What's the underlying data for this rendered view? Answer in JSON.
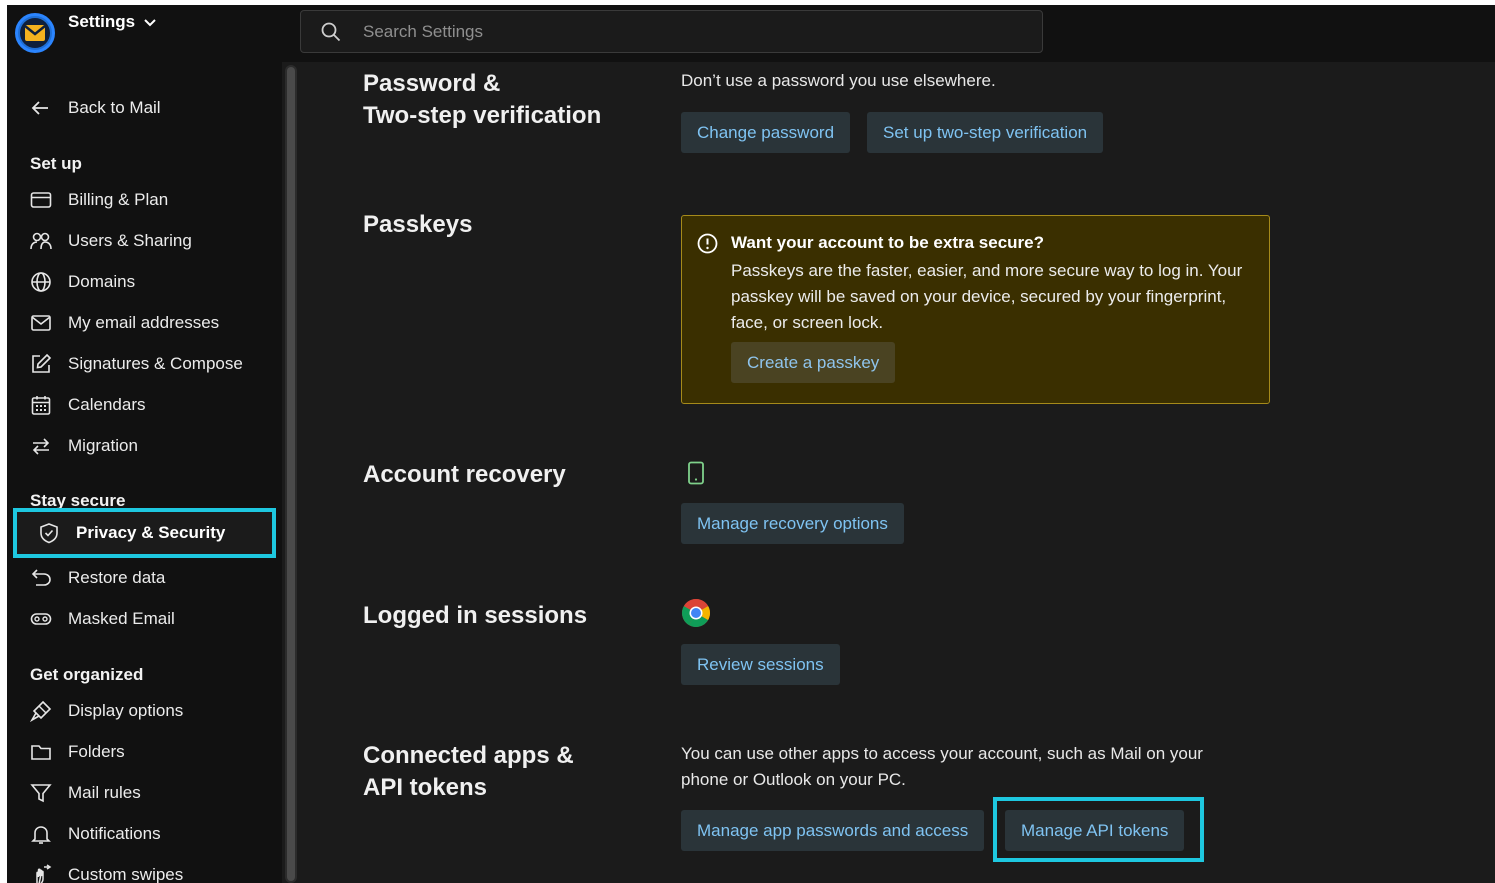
{
  "header": {
    "app_title": "Settings",
    "search_placeholder": "Search Settings"
  },
  "sidebar": {
    "back": "Back to Mail",
    "sections": {
      "setup": "Set up",
      "stay_secure": "Stay secure",
      "get_organized": "Get organized"
    },
    "items": {
      "billing": "Billing & Plan",
      "users": "Users & Sharing",
      "domains": "Domains",
      "emails": "My email addresses",
      "signatures": "Signatures & Compose",
      "calendars": "Calendars",
      "migration": "Migration",
      "privacy": "Privacy & Security",
      "restore": "Restore data",
      "masked": "Masked Email",
      "display": "Display options",
      "folders": "Folders",
      "rules": "Mail rules",
      "notifications": "Notifications",
      "swipes": "Custom swipes"
    },
    "active_item": "Privacy & Security"
  },
  "main": {
    "password": {
      "title_line1": "Password &",
      "title_line2": "Two-step verification",
      "description": "Don’t use a password you use elsewhere.",
      "btn_change": "Change password",
      "btn_two_step": "Set up two-step verification"
    },
    "passkeys": {
      "title": "Passkeys",
      "warning_title": "Want your account to be extra secure?",
      "warning_body": "Passkeys are the faster, easier, and more secure way to log in. Your passkey will be saved on your device, secured by your fingerprint, face, or screen lock.",
      "btn_create": "Create a passkey"
    },
    "recovery": {
      "title": "Account recovery",
      "icon": "phone-icon",
      "btn_manage": "Manage recovery options"
    },
    "sessions": {
      "title": "Logged in sessions",
      "icon": "chrome-icon",
      "btn_review": "Review sessions"
    },
    "connected": {
      "title_line1": "Connected apps &",
      "title_line2": "API tokens",
      "description": "You can use other apps to access your account, such as Mail on your phone or Outlook on your PC.",
      "btn_app_passwords": "Manage app passwords and access",
      "btn_api_tokens": "Manage API tokens"
    }
  },
  "colors": {
    "highlight": "#1ec8e0",
    "button_text": "#7fc3f2",
    "warning_bg": "#3a2f00"
  }
}
